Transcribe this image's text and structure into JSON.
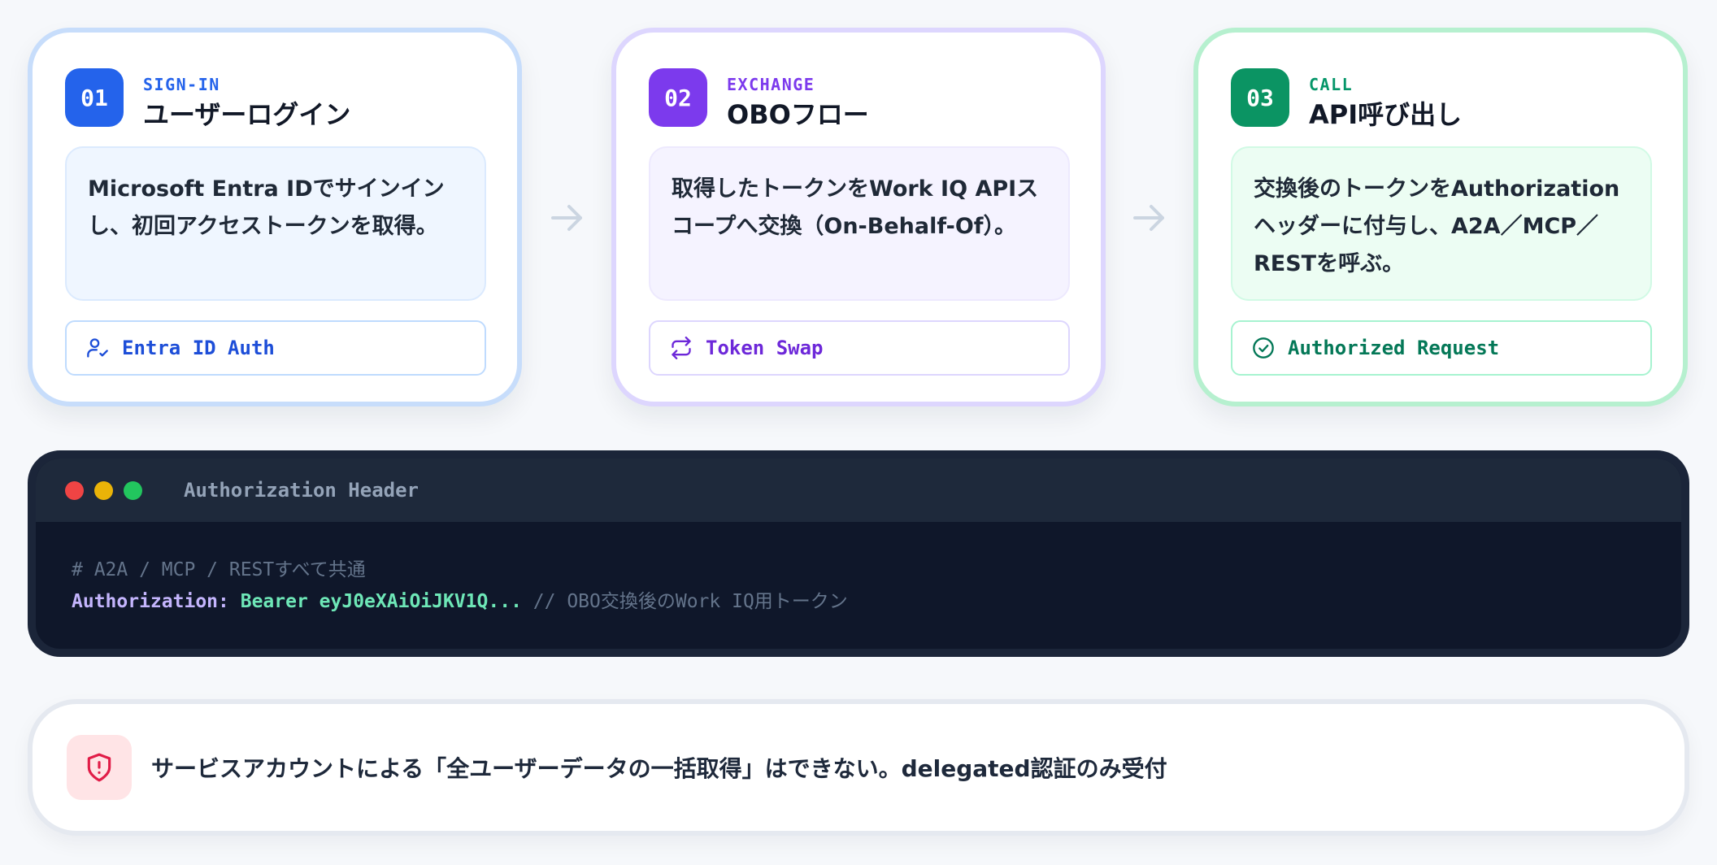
{
  "steps": [
    {
      "number": "01",
      "kicker": "SIGN-IN",
      "title": "ユーザーログイン",
      "description_lines": [
        "Microsoft Entra IDでサインイン",
        "し、初回アクセストークンを取得。"
      ],
      "tag": "Entra ID Auth",
      "tag_icon": "user-check-icon"
    },
    {
      "number": "02",
      "kicker": "EXCHANGE",
      "title": "OBOフロー",
      "description_lines": [
        "取得したトークンをWork IQ APIス",
        "コープへ交換（On-Behalf-Of）。"
      ],
      "tag": "Token Swap",
      "tag_icon": "swap-arrows-icon"
    },
    {
      "number": "03",
      "kicker": "CALL",
      "title": "API呼び出し",
      "description_lines": [
        "交換後のトークンをAuthorization",
        "ヘッダーに付与し、A2A／MCP／",
        "RESTを呼ぶ。"
      ],
      "tag": "Authorized Request",
      "tag_icon": "check-circle-icon"
    }
  ],
  "arrow_icon": "arrow-right-icon",
  "terminal": {
    "title": "Authorization Header",
    "comment": "# A2A / MCP / RESTすべて共通",
    "header_key": "Authorization:",
    "header_value": "Bearer eyJ0eXAiOiJKV1Q...",
    "inline_comment": "// OBO交換後のWork IQ用トークン"
  },
  "note": {
    "icon": "shield-alert-icon",
    "text": "サービスアカウントによる「全ユーザーデータの一括取得」はできない。delegated認証のみ受付"
  },
  "colors": {
    "step1": "#2463eb",
    "step2": "#7c3aed",
    "step3": "#0b9463",
    "terminal_bg": "#0f172a",
    "note_icon_bg": "#ffe4e6",
    "note_icon": "#e11d48"
  }
}
